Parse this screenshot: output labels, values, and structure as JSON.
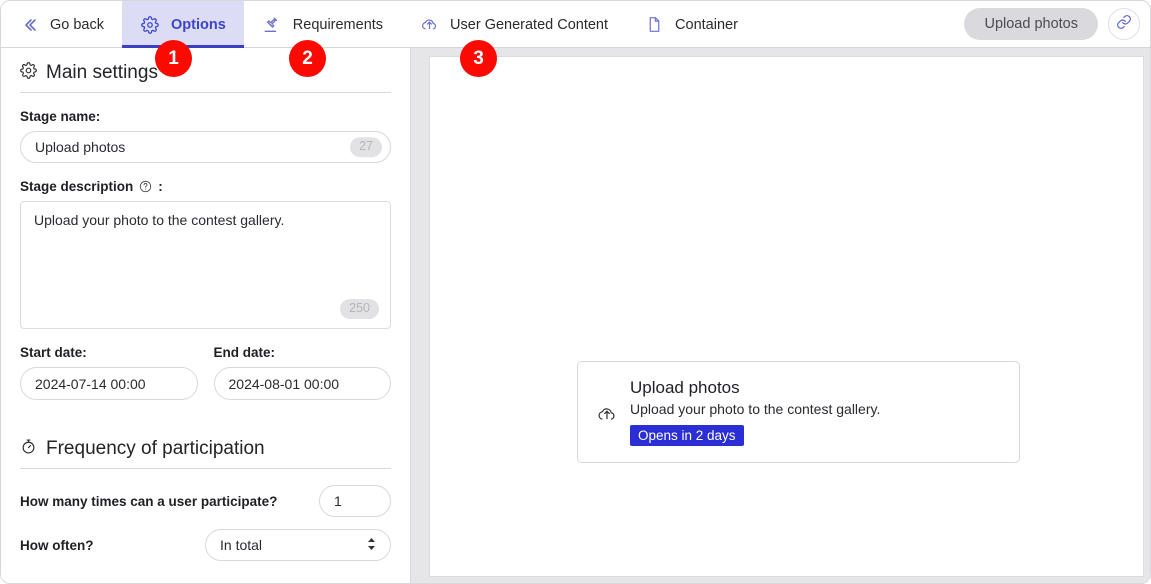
{
  "toolbar": {
    "tabs": [
      {
        "label": "Go back",
        "icon": "chevrons-left-icon",
        "active": false
      },
      {
        "label": "Options",
        "icon": "gear-icon",
        "active": true
      },
      {
        "label": "Requirements",
        "icon": "stamp-icon",
        "active": false
      },
      {
        "label": "User Generated Content",
        "icon": "cloud-upload-icon",
        "active": false
      },
      {
        "label": "Container",
        "icon": "document-icon",
        "active": false
      }
    ],
    "upload_button_label": "Upload photos",
    "link_icon": "link-icon"
  },
  "main_settings": {
    "heading": "Main settings",
    "heading_icon": "gear-icon",
    "stage_name_label": "Stage name:",
    "stage_name_value": "Upload photos",
    "stage_name_counter": "27",
    "stage_description_label": "Stage description",
    "stage_description_help_icon": "help-circle-icon",
    "stage_description_label_suffix": ":",
    "stage_description_value": "Upload your photo to the contest gallery.",
    "stage_description_counter": "250",
    "start_date_label": "Start date:",
    "start_date_value": "2024-07-14 00:00",
    "end_date_label": "End date:",
    "end_date_value": "2024-08-01 00:00"
  },
  "frequency": {
    "heading": "Frequency of participation",
    "heading_icon": "stopwatch-icon",
    "times_label": "How many times can a user participate?",
    "times_value": "1",
    "how_often_label": "How often?",
    "how_often_value": "In total",
    "how_often_options": [
      "In total"
    ]
  },
  "preview": {
    "card": {
      "icon": "cloud-upload-icon",
      "title": "Upload photos",
      "description": "Upload your photo to the contest gallery.",
      "badge": "Opens in 2 days",
      "badge_color": "#2b2ed4"
    }
  },
  "markers": [
    {
      "number": "1"
    },
    {
      "number": "2"
    },
    {
      "number": "3"
    }
  ],
  "colors": {
    "accent": "#3c45c8",
    "active_tab_bg": "#dcdcf5",
    "marker": "#fa0a00",
    "badge": "#2b2ed4"
  }
}
